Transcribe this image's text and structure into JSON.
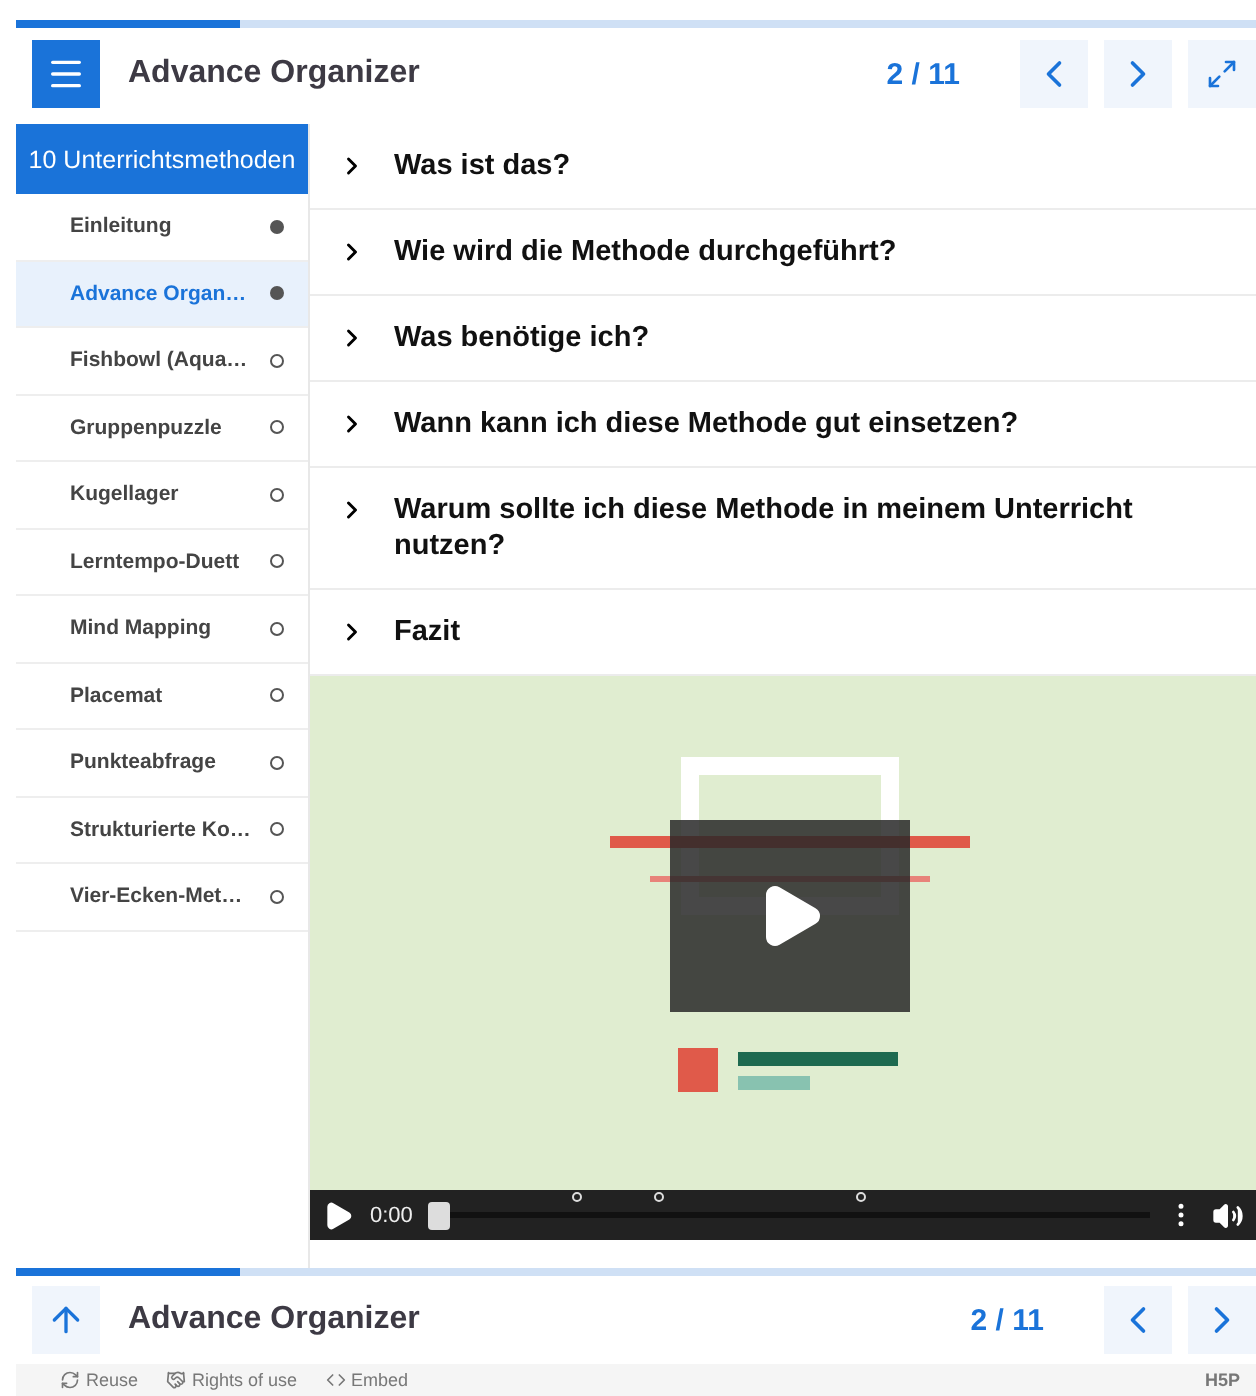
{
  "top_bar": {
    "progress": {
      "level": 0.18
    },
    "title": "Advance Organizer",
    "counter": "2 / 11"
  },
  "sidebar": {
    "heading": "10 Unterrichtsmethoden",
    "items": [
      {
        "label": "Einleitung",
        "selected": false,
        "done": true
      },
      {
        "label": "Advance Organ…",
        "selected": true,
        "done": true
      },
      {
        "label": "Fishbowl (Aqua…",
        "selected": false,
        "done": false
      },
      {
        "label": "Gruppenpuzzle",
        "selected": false,
        "done": false
      },
      {
        "label": "Kugellager",
        "selected": false,
        "done": false
      },
      {
        "label": "Lerntempo-Duett",
        "selected": false,
        "done": false
      },
      {
        "label": "Mind Mapping",
        "selected": false,
        "done": false
      },
      {
        "label": "Placemat",
        "selected": false,
        "done": false
      },
      {
        "label": "Punkteabfrage",
        "selected": false,
        "done": false
      },
      {
        "label": "Strukturierte Ko…",
        "selected": false,
        "done": false
      },
      {
        "label": "Vier-Ecken-Met…",
        "selected": false,
        "done": false
      }
    ]
  },
  "accordion": [
    {
      "title": "Was ist das?",
      "expanded": false
    },
    {
      "title": "Wie wird die Methode durchgeführt?",
      "expanded": false
    },
    {
      "title": "Was benötige ich?",
      "expanded": false
    },
    {
      "title": "Wann kann ich diese Methode gut einsetzen?",
      "expanded": false
    },
    {
      "title": "Warum sollte ich diese Methode in meinem Unterricht nutzen?",
      "expanded": false
    },
    {
      "title": "Fazit",
      "expanded": false
    }
  ],
  "video": {
    "kind": "picture",
    "time": "0:00",
    "progress": {
      "level": 0
    }
  },
  "bottom_bar": {
    "progress": {
      "level": 0.18
    },
    "title": "Advance Organizer",
    "counter": "2 / 11"
  },
  "footer": {
    "links": [
      {
        "label": "Reuse",
        "kind": "reuse"
      },
      {
        "label": "Rights of use",
        "kind": "rights"
      },
      {
        "label": "Embed",
        "kind": "embed"
      }
    ],
    "logo": "H5P"
  }
}
